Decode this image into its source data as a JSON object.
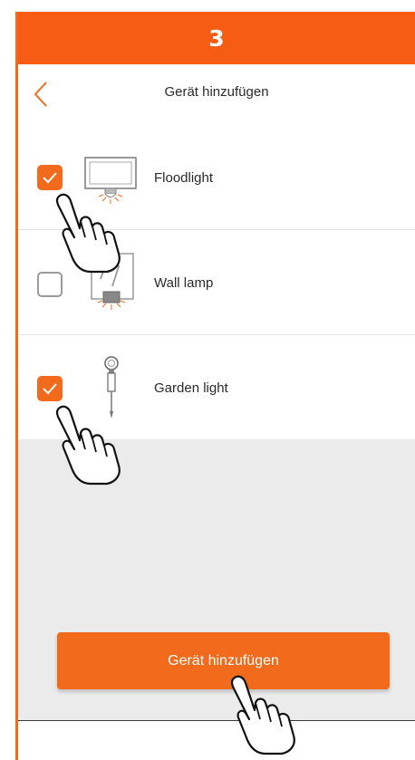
{
  "step": {
    "number": "3"
  },
  "header": {
    "title": "Gerät hinzufügen",
    "back_icon": "chevron-left-icon"
  },
  "devices": [
    {
      "label": "Floodlight",
      "checked": true,
      "icon": "floodlight-icon"
    },
    {
      "label": "Wall lamp",
      "checked": false,
      "icon": "wall-lamp-icon"
    },
    {
      "label": "Garden light",
      "checked": true,
      "icon": "garden-light-icon"
    }
  ],
  "action": {
    "add_label": "Gerät hinzufügen"
  },
  "colors": {
    "accent": "#f26a1b",
    "step_bar": "#f75c14",
    "panel": "#ebebeb"
  }
}
